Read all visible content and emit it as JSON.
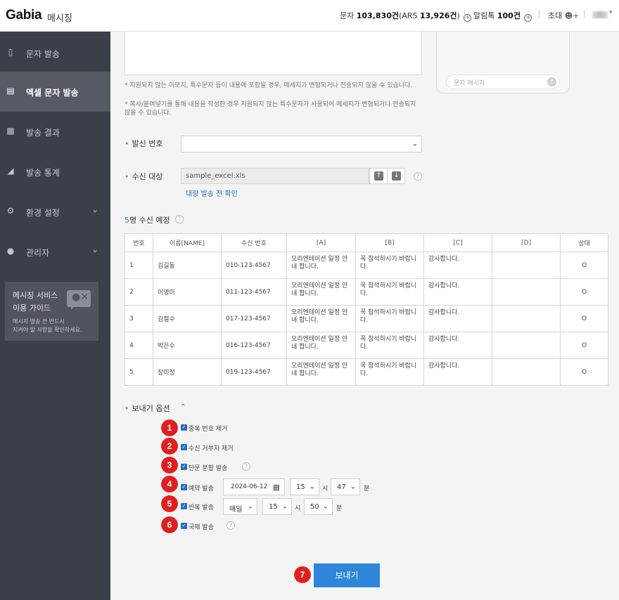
{
  "header": {
    "logo": "Gabia",
    "logo_sub": "메시징",
    "sms_prefix": "문자",
    "sms_count": "103,830건",
    "ars_prefix": "(ARS",
    "ars_count": "13,926건",
    "ars_suffix": ")",
    "alimtalk_prefix": "알림톡",
    "alimtalk_count": "100건",
    "invite": "초대"
  },
  "sidebar": {
    "items": [
      {
        "label": "문자 발송",
        "icon": "mobile-icon"
      },
      {
        "label": "엑셀 문자 발송",
        "icon": "excel-file-icon"
      },
      {
        "label": "발송 결과",
        "icon": "inbox-icon"
      },
      {
        "label": "발송 통계",
        "icon": "area-chart-icon"
      },
      {
        "label": "환경 설정",
        "icon": "gear-icon"
      },
      {
        "label": "관리자",
        "icon": "user-circle-icon"
      }
    ],
    "guide": {
      "title1": "메시징 서비스",
      "title2": "이용 가이드",
      "desc1": "메시지 발송 전 반드시",
      "desc2": "지켜야 할 사항을 확인하세요."
    }
  },
  "notes": {
    "note1": "*  지원되지 않는 이모지, 특수문자 등이 내용에 포함될 경우, 메세지가 변형되거나 전송되지 않을 수 있습니다.",
    "note2": "*  복사/붙여넣기를 통해 내용을 작성한 경우 지원되지 않는 특수문자가 사용되어 메세지가 변형되거나 전송되지 않을 수 있습니다."
  },
  "phone_preview": {
    "placeholder": "문자 메시지"
  },
  "sender": {
    "label": "발신 번호",
    "value": ""
  },
  "recipient": {
    "label": "수신 대상",
    "file": "sample_excel.xls",
    "link": "대량 발송 전 확인"
  },
  "count": {
    "number": "5",
    "text": "명 수신 예정"
  },
  "table": {
    "headers": [
      "번호",
      "이름[NAME]",
      "수신 번호",
      "[A]",
      "[B]",
      "[C]",
      "[D]",
      "상태"
    ],
    "rows": [
      [
        "1",
        "김길동",
        "010-123-4567",
        "오리엔테이션 일정 안내 합니다.",
        "꼭 참석하시기 바랍니다.",
        "감사합니다.",
        "",
        "O"
      ],
      [
        "2",
        "이영미",
        "011-123-4567",
        "오리엔테이션 일정 안내 합니다.",
        "꼭 참석하시기 바랍니다.",
        "감사합니다.",
        "",
        "O"
      ],
      [
        "3",
        "김철수",
        "017-123-4567",
        "오리엔테이션 일정 안내 합니다.",
        "꼭 참석하시기 바랍니다.",
        "감사합니다.",
        "",
        "O"
      ],
      [
        "4",
        "박은수",
        "016-123-4567",
        "오리엔테이션 일정 안내 합니다.",
        "꼭 참석하시기 바랍니다.",
        "감사합니다.",
        "",
        "O"
      ],
      [
        "5",
        "장미정",
        "019-123-4567",
        "오리엔테이션 일정 안내 합니다.",
        "꼭 참석하시기 바랍니다.",
        "감사합니다.",
        "",
        "O"
      ]
    ]
  },
  "options": {
    "title": "보내기 옵션",
    "items": [
      {
        "badge": "1",
        "label": "중복 번호 제거"
      },
      {
        "badge": "2",
        "label": "수신 거부자 제거"
      },
      {
        "badge": "3",
        "label": "단문 분할 발송"
      },
      {
        "badge": "4",
        "label": "예약 발송"
      },
      {
        "badge": "5",
        "label": "반복 발송"
      },
      {
        "badge": "6",
        "label": "국제 발송"
      }
    ],
    "reserve": {
      "date": "2024-06-12",
      "hour": "15",
      "hour_unit": "시",
      "minute": "47",
      "minute_unit": "분"
    },
    "repeat": {
      "period": "매일",
      "hour": "15",
      "hour_unit": "시",
      "minute": "50",
      "minute_unit": "분"
    }
  },
  "send": {
    "badge": "7",
    "label": "보내기"
  },
  "colors": {
    "accent": "#2d86d9",
    "badge": "#e02020",
    "sidebar": "#3b3f48"
  }
}
